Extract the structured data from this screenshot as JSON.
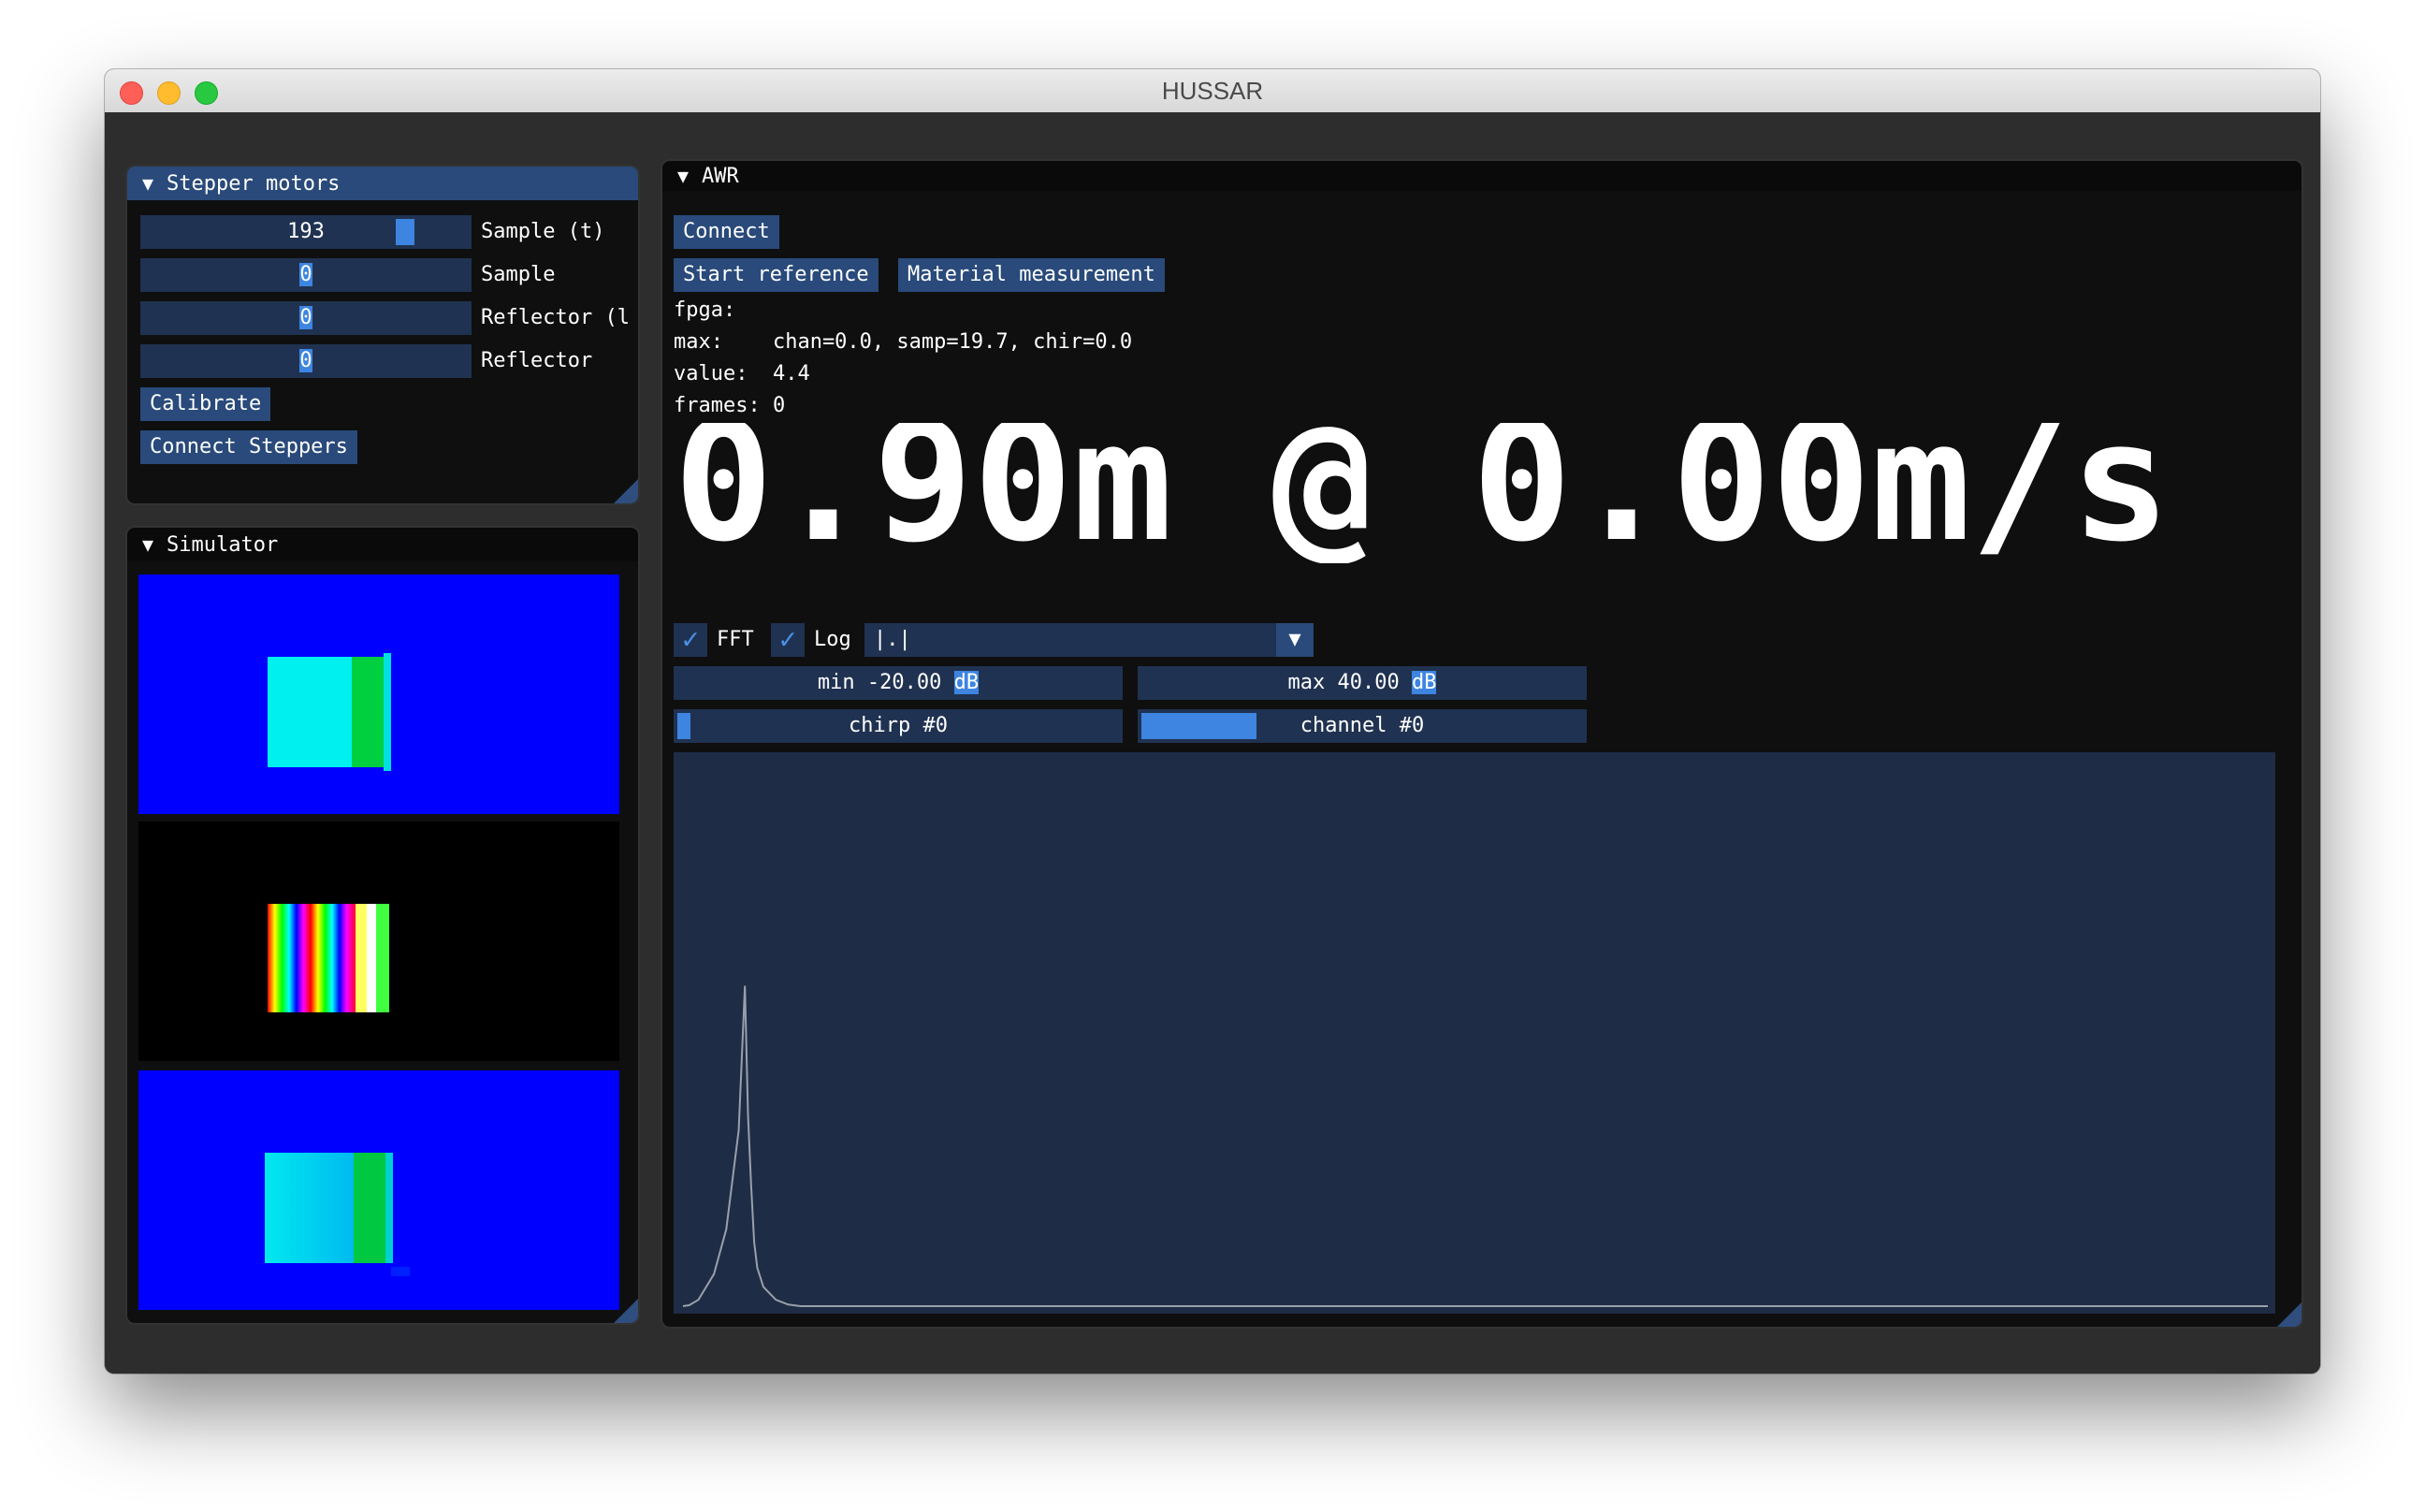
{
  "window": {
    "title": "HUSSAR"
  },
  "stepper_panel": {
    "title": "Stepper motors",
    "sliders": [
      {
        "value": "193",
        "label": "Sample (t)",
        "fill": 0.78
      },
      {
        "value": "0",
        "label": "Sample",
        "fill": 0.5
      },
      {
        "value": "0",
        "label": "Reflector (l",
        "fill": 0.5
      },
      {
        "value": "0",
        "label": "Reflector",
        "fill": 0.5
      }
    ],
    "calibrate_label": "Calibrate",
    "connect_label": "Connect Steppers"
  },
  "simulator_panel": {
    "title": "Simulator"
  },
  "awr_panel": {
    "title": "AWR",
    "connect_label": "Connect",
    "start_reference_label": "Start reference",
    "material_measurement_label": "Material measurement",
    "info_lines": [
      "fpga:",
      "max:    chan=0.0, samp=19.7, chir=0.0",
      "value:  4.4",
      "frames: 0"
    ],
    "readout": "0.90m @ 0.00m/s",
    "fft_label": "FFT",
    "log_label": "Log",
    "fft_checked": true,
    "log_checked": true,
    "combo_value": "|.|",
    "min_prefix": "min -20.00 ",
    "min_unit": "dB",
    "max_prefix": "max 40.00 ",
    "max_unit": "dB",
    "chirp_label": "chirp #0",
    "chirp_fill": 0.02,
    "channel_label": "channel #0",
    "channel_fill": 0.26
  },
  "chart_data": {
    "type": "line",
    "series": [
      {
        "x": [
          0,
          2,
          5,
          10,
          14,
          18,
          20,
          21,
          22,
          23,
          24,
          26,
          30,
          34,
          38,
          100,
          200,
          300,
          400,
          512
        ],
        "y": [
          0,
          0.3,
          2,
          10,
          24,
          55,
          100,
          60,
          38,
          20,
          12,
          6,
          2,
          0.5,
          0,
          0,
          0,
          0,
          0,
          0
        ]
      }
    ],
    "ylim": [
      0,
      170
    ]
  },
  "colors": {
    "accent": "#294a7a",
    "frame_bg": "#203251",
    "grab": "#3d85e0",
    "plot_bg": "#1f2c46"
  }
}
